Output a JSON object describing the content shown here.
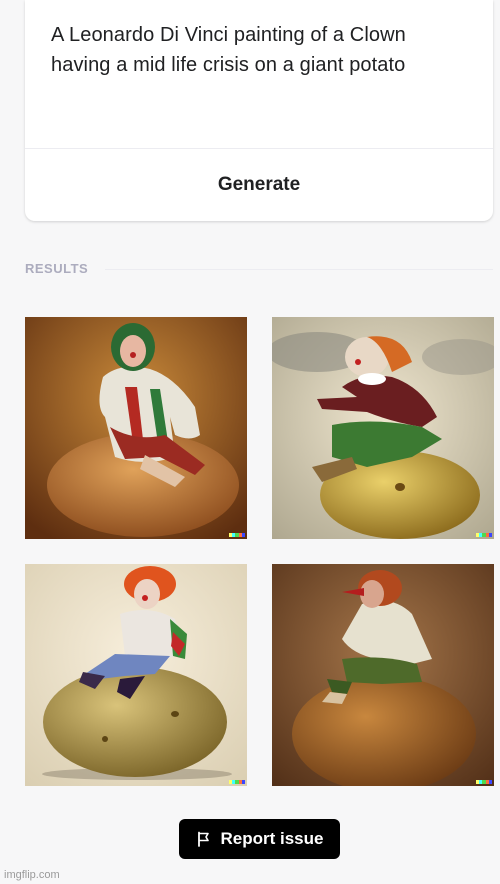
{
  "prompt": {
    "line1": "A Leonardo Di Vinci painting of a Clown",
    "line2": "having a mid life crisis on a giant potato"
  },
  "generate_label": "Generate",
  "results": {
    "label": "RESULTS",
    "images": [
      {
        "name": "result-image-1"
      },
      {
        "name": "result-image-2"
      },
      {
        "name": "result-image-3"
      },
      {
        "name": "result-image-4"
      }
    ]
  },
  "report_label": "Report issue",
  "watermark": "imgflip.com",
  "icons": {
    "report": "flag-icon"
  },
  "colors": {
    "background": "#f7f7f8",
    "button_bg": "#000000",
    "text": "#202123",
    "muted": "#acacbe"
  }
}
